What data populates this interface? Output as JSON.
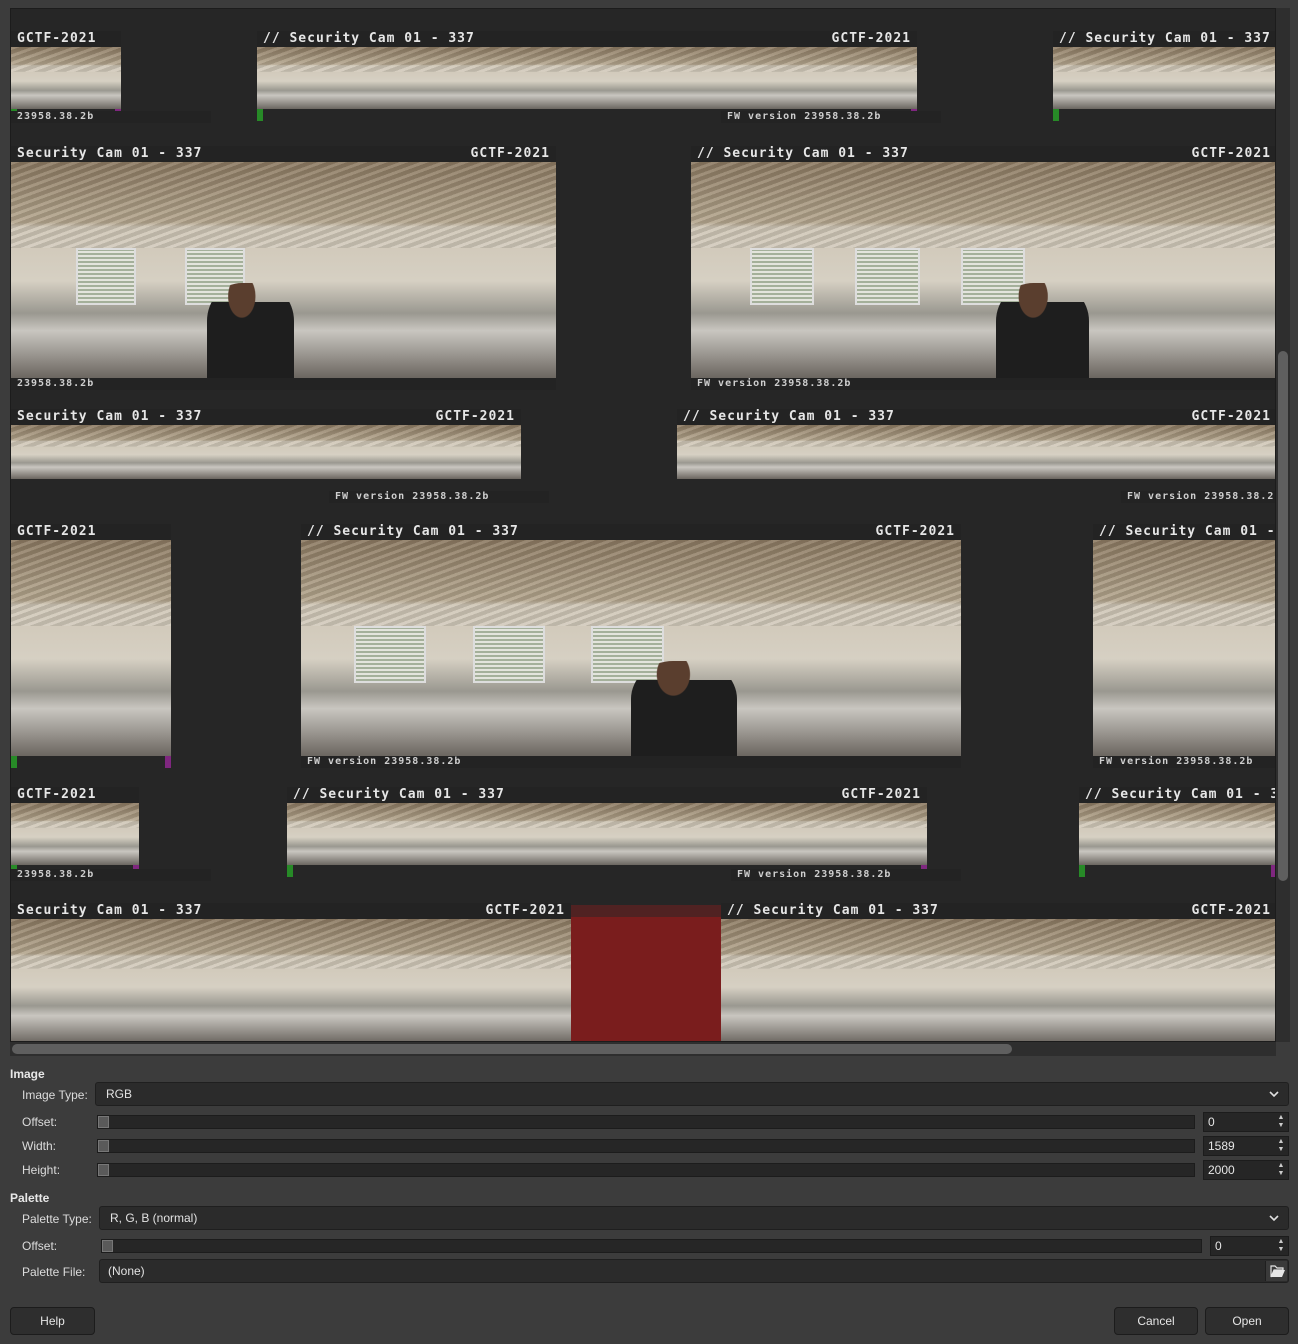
{
  "preview": {
    "overlay_title": "// Security Cam 01 - 337",
    "overlay_title_short": "Security Cam 01 - 337",
    "overlay_tag": "GCTF-2021",
    "overlay_fw": "FW version 23958.38.2b",
    "overlay_fw_short": "23958.38.2b"
  },
  "image": {
    "section_label": "Image",
    "type_label": "Image Type:",
    "type_value": "RGB",
    "offset_label": "Offset:",
    "offset_value": "0",
    "width_label": "Width:",
    "width_value": "1589",
    "height_label": "Height:",
    "height_value": "2000"
  },
  "palette": {
    "section_label": "Palette",
    "type_label": "Palette Type:",
    "type_value": "R, G, B (normal)",
    "offset_label": "Offset:",
    "offset_value": "0",
    "file_label": "Palette File:",
    "file_value": "(None)"
  },
  "buttons": {
    "help": "Help",
    "cancel": "Cancel",
    "open": "Open"
  },
  "icons": {
    "dropdown": "chevron-down-icon",
    "folder": "folder-open-icon",
    "spin": "spin-arrows-icon"
  }
}
